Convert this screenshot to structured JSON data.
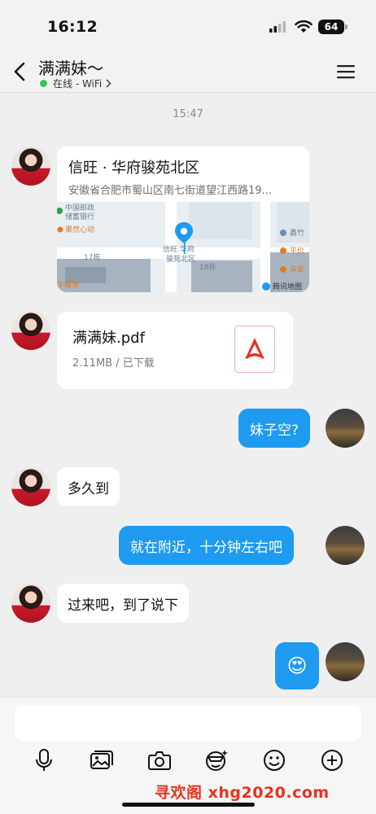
{
  "status_bar": {
    "time": "16:12",
    "battery": "64"
  },
  "header": {
    "contact_name": "满满妹～",
    "presence": "在线 - WiFi"
  },
  "chat": {
    "timestamp": "15:47",
    "location": {
      "title": "信旺 · 华府骏苑北区",
      "address": "安徽省合肥市蜀山区南七街道望江西路19...",
      "map_labels": [
        "中国邮政",
        "储蓄银行",
        "果然心动",
        "17栋",
        "丰蝶来",
        "信旺 华府",
        "骏苑北区",
        "18栋",
        "鑫竹",
        "平价",
        "宋家",
        "腾讯地图"
      ]
    },
    "file": {
      "name": "满满妹.pdf",
      "meta": "2.11MB / 已下载"
    },
    "messages": [
      {
        "from": "me",
        "text": "妹子空?"
      },
      {
        "from": "her",
        "text": "多久到"
      },
      {
        "from": "me",
        "text": "就在附近，十分钟左右吧"
      },
      {
        "from": "her",
        "text": "过来吧，到了说下"
      },
      {
        "from": "me",
        "text": "😍"
      }
    ]
  },
  "composer": {
    "placeholder": "",
    "tools": [
      "microphone-icon",
      "image-icon",
      "camera-icon",
      "ai-sticker-icon",
      "emoji-icon",
      "plus-icon"
    ]
  },
  "watermark": "寻欢阁 xhg2020.com",
  "colors": {
    "accent": "#1e9bf0",
    "online": "#35c55a",
    "watermark": "#e8321e"
  }
}
